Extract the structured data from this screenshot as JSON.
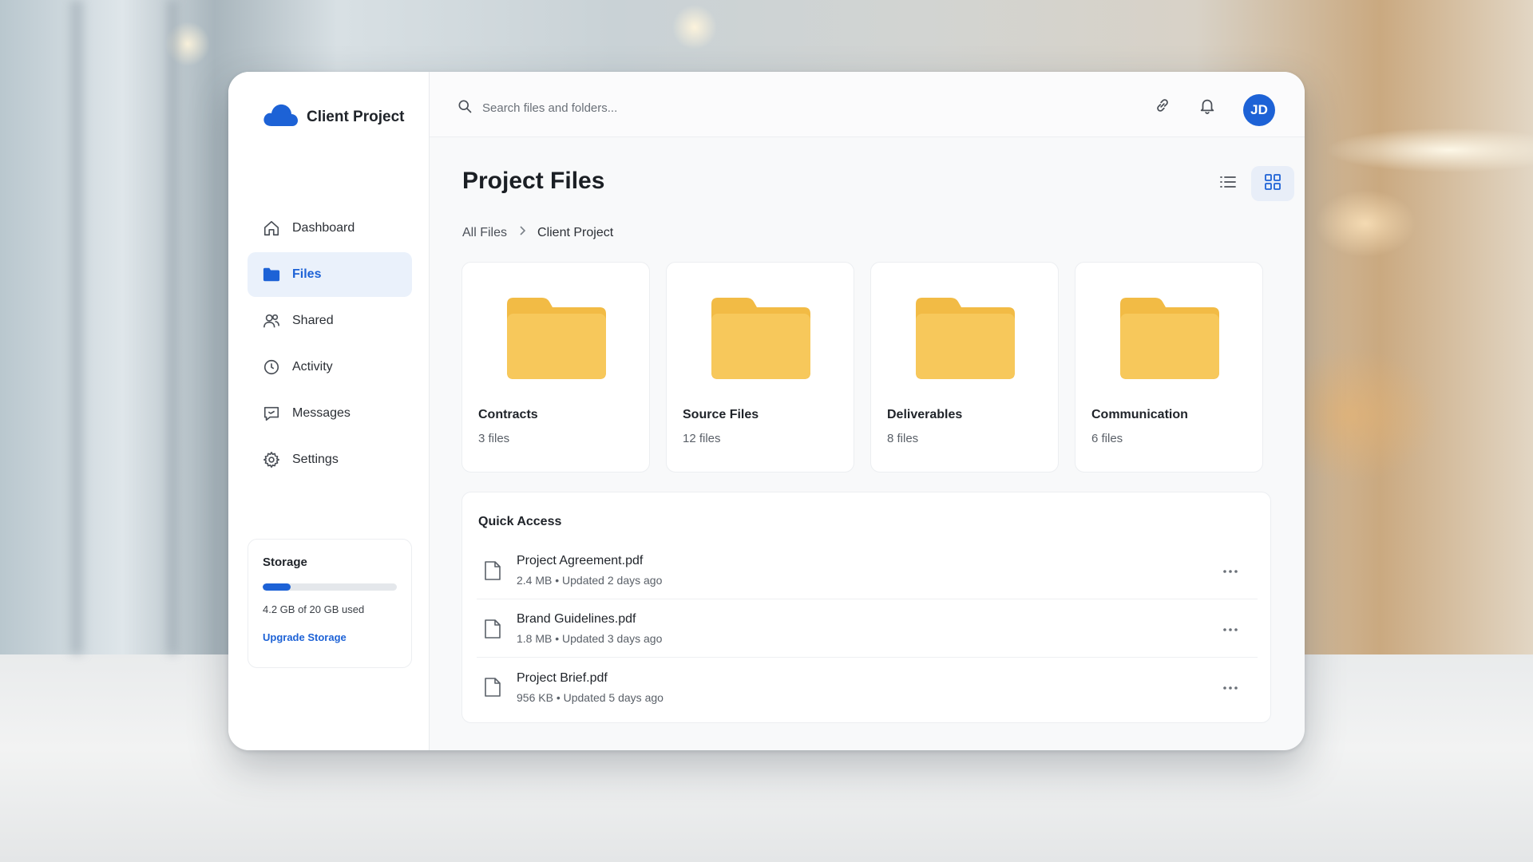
{
  "brand": {
    "name": "Client Project",
    "icon": "cloud-icon",
    "color": "#1d62d6"
  },
  "sidebar": {
    "items": [
      {
        "label": "Dashboard",
        "icon": "home-icon",
        "active": false
      },
      {
        "label": "Files",
        "icon": "folder-icon",
        "active": true
      },
      {
        "label": "Shared",
        "icon": "users-icon",
        "active": false
      },
      {
        "label": "Activity",
        "icon": "clock-icon",
        "active": false
      },
      {
        "label": "Messages",
        "icon": "message-icon",
        "active": false
      },
      {
        "label": "Settings",
        "icon": "gear-icon",
        "active": false
      }
    ]
  },
  "storage": {
    "title": "Storage",
    "used_text": "4.2 GB of 20 GB used",
    "used_fraction": 0.21,
    "upgrade_label": "Upgrade Storage"
  },
  "topbar": {
    "search_placeholder": "Search files and folders...",
    "link_icon": "link-icon",
    "bell_icon": "bell-icon",
    "avatar_initials": "JD"
  },
  "page": {
    "title": "Project Files",
    "view_modes": [
      "list-view-icon",
      "grid-view-icon"
    ],
    "active_view": "grid"
  },
  "breadcrumb": {
    "root": "All Files",
    "current": "Client Project"
  },
  "folders": [
    {
      "name": "Contracts",
      "count": "3 files"
    },
    {
      "name": "Source Files",
      "count": "12 files"
    },
    {
      "name": "Deliverables",
      "count": "8 files"
    },
    {
      "name": "Communication",
      "count": "6 files"
    }
  ],
  "quick_access": {
    "title": "Quick Access",
    "files": [
      {
        "name": "Project Agreement.pdf",
        "meta": "2.4 MB • Updated 2 days ago"
      },
      {
        "name": "Brand Guidelines.pdf",
        "meta": "1.8 MB • Updated 3 days ago"
      },
      {
        "name": "Project Brief.pdf",
        "meta": "956 KB • Updated 5 days ago"
      }
    ]
  },
  "colors": {
    "accent": "#1d62d6",
    "folder": "#f7c85b",
    "folder_tab": "#f2bb45"
  }
}
